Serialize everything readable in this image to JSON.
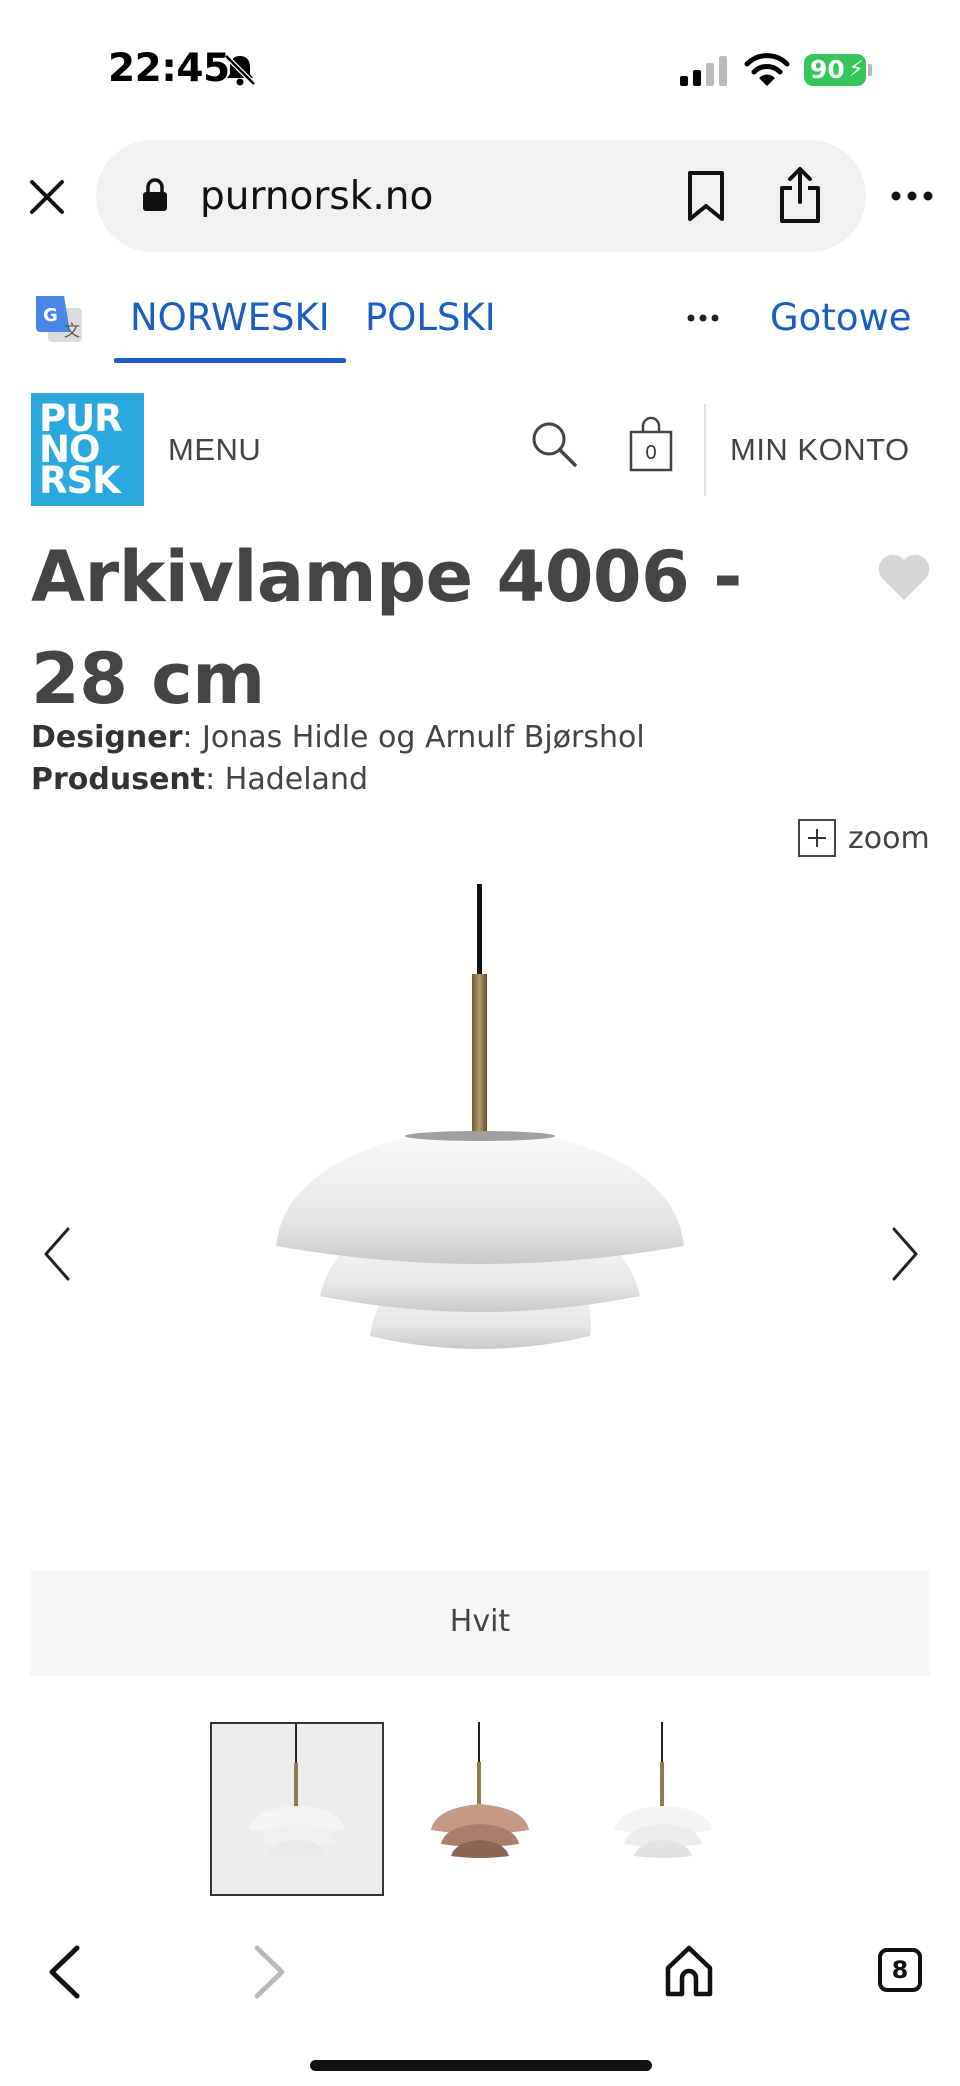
{
  "status_bar": {
    "time": "22:45",
    "battery": "90",
    "icons": [
      "bell-slash-icon",
      "signal-icon",
      "wifi-icon",
      "battery-charging-icon"
    ]
  },
  "browser": {
    "url": "purnorsk.no",
    "icons": [
      "close-icon",
      "lock-icon",
      "bookmark-icon",
      "share-icon",
      "more-icon"
    ]
  },
  "translate_bar": {
    "source_lang": "NORWESKI",
    "target_lang": "POLSKI",
    "done": "Gotowe",
    "accent": "#1a5ec2"
  },
  "site_header": {
    "logo_lines": [
      "PUR",
      "NO",
      "RSK"
    ],
    "logo_color": "#2ba9de",
    "menu": "MENU",
    "cart_count": "0",
    "account": "MIN KONTO"
  },
  "product": {
    "title": "Arkivlampe 4006 - 28 cm",
    "designer_label": "Designer",
    "designer_value": ": Jonas Hidle og Arnulf Bjørshol",
    "producer_label": "Produsent",
    "producer_value": ": Hadeland",
    "zoom": "zoom",
    "variant": "Hvit"
  },
  "thumbnails": [
    {
      "name": "thumb-white",
      "color": "#f2f2f2",
      "selected": true
    },
    {
      "name": "thumb-amber",
      "color": "#b88a72",
      "selected": false
    },
    {
      "name": "thumb-white-alt",
      "color": "#f2f2f2",
      "selected": false
    }
  ],
  "bottom_toolbar": {
    "tab_count": "8"
  }
}
